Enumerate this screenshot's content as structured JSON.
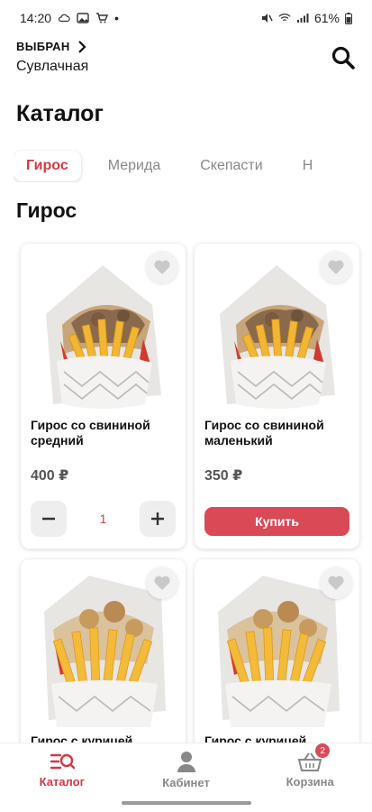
{
  "status_bar": {
    "time": "14:20",
    "dot": "•",
    "battery": "61%"
  },
  "header": {
    "selected_label": "ВЫБРАН",
    "store_name": "Сувлачная",
    "search_icon": "search-icon"
  },
  "page_title": "Каталог",
  "tabs": [
    {
      "label": "Гирос",
      "active": true
    },
    {
      "label": "Мерида",
      "active": false
    },
    {
      "label": "Скепасти",
      "active": false
    },
    {
      "label": "Н",
      "active": false
    }
  ],
  "section_title": "Гирос",
  "products": [
    {
      "title": "Гирос со свининой средний",
      "price": "400 ₽",
      "quantity": "1",
      "in_cart": true,
      "filling": "pork"
    },
    {
      "title": "Гирос со свининой маленький",
      "price": "350 ₽",
      "buy_label": "Купить",
      "in_cart": false,
      "filling": "pork"
    },
    {
      "title": "Гирос с курицей",
      "filling": "chicken"
    },
    {
      "title": "Гирос с курицей",
      "filling": "chicken"
    }
  ],
  "stepper": {
    "minus": "−",
    "plus": "+"
  },
  "bottom_nav": [
    {
      "label": "Каталог",
      "icon": "catalog-search-icon",
      "active": true
    },
    {
      "label": "Кабинет",
      "icon": "user-icon",
      "active": false
    },
    {
      "label": "Корзина",
      "icon": "basket-icon",
      "active": false,
      "badge": "2"
    }
  ],
  "colors": {
    "accent": "#d23a46",
    "buy_button": "#d94a56",
    "muted": "#888888"
  }
}
